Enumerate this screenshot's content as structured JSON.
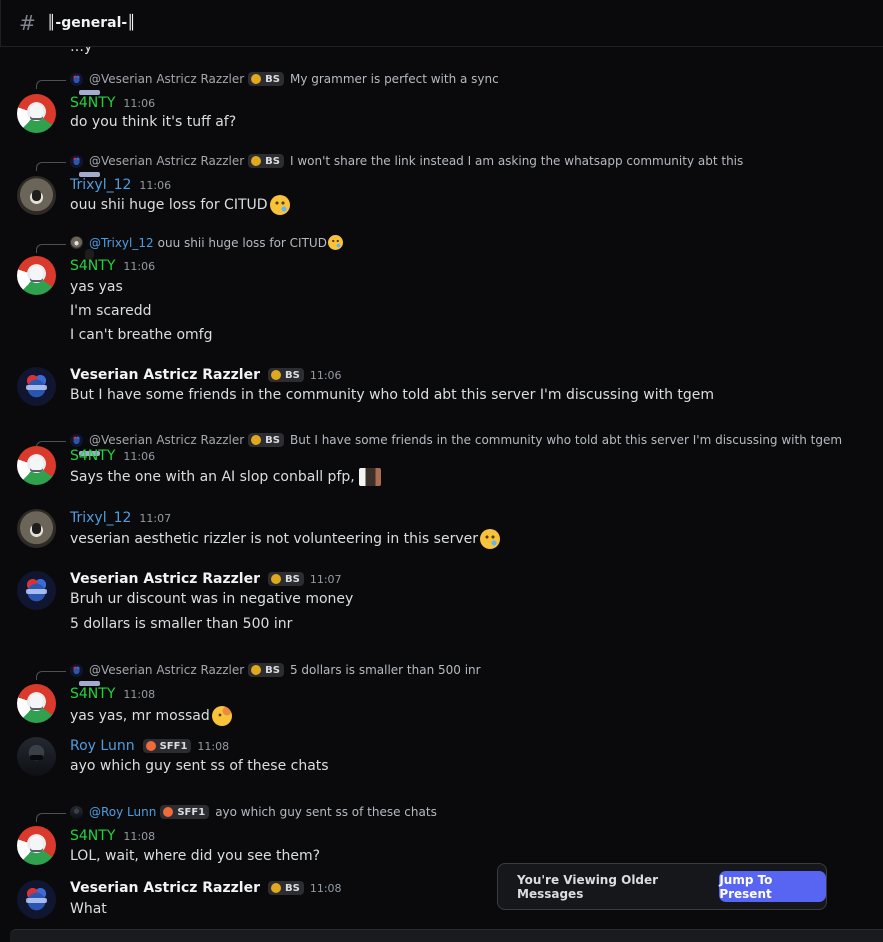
{
  "channel": {
    "icon": "hash-icon",
    "name": "║-general-║"
  },
  "cut_text": "…y",
  "messages": [
    {
      "reply": {
        "author": "@Veserian Astricz Razzler",
        "tag": "BS",
        "text": "My grammer is perfect with a sync"
      },
      "author": "S4NTY",
      "time": "11:06",
      "lines": [
        "do you think it's tuff af?"
      ]
    },
    {
      "reply": {
        "author": "@Veserian Astricz Razzler",
        "tag": "BS",
        "text": "I won't share the link instead I am asking the whatsapp community abt this"
      },
      "author": "Trixyl_12",
      "time": "11:06",
      "lines": [
        "ouu shii huge loss for CITUD"
      ],
      "emoji": "crying-face"
    },
    {
      "reply": {
        "author": "@Trixyl_12",
        "text": "ouu shii huge loss for CITUD"
      },
      "author": "S4NTY",
      "time": "11:06",
      "lines": [
        "yas yas",
        "I'm scaredd",
        "I can't breathe omfg"
      ]
    },
    {
      "author": "Veserian Astricz Razzler",
      "tag": "BS",
      "time": "11:06",
      "lines": [
        "But I have some friends in the community who told abt this server I'm discussing with tgem"
      ]
    },
    {
      "reply": {
        "author": "@Veserian Astricz Razzler",
        "tag": "BS",
        "text": "But I have some friends in the community who told abt this server I'm discussing with tgem"
      },
      "author": "S4NTY",
      "time": "11:06",
      "lines": [
        "Says the one with an AI slop conball pfp,"
      ]
    },
    {
      "author": "Trixyl_12",
      "time": "11:07",
      "lines": [
        "veserian aesthetic rizzler is not volunteering in this server"
      ]
    },
    {
      "author": "Veserian Astricz Razzler",
      "tag": "BS",
      "time": "11:07",
      "lines": [
        "Bruh ur discount was in negative money",
        "5 dollars is smaller than 500 inr"
      ]
    },
    {
      "reply": {
        "author": "@Veserian Astricz Razzler",
        "tag": "BS",
        "text": "5 dollars is smaller than 500 inr"
      },
      "author": "S4NTY",
      "time": "11:08",
      "lines": [
        "yas yas, mr mossad"
      ]
    },
    {
      "author": "Roy Lunn",
      "tag": "SFF1",
      "time": "11:08",
      "lines": [
        "ayo which guy sent ss of these chats"
      ]
    },
    {
      "reply": {
        "author": "@Roy Lunn",
        "tag": "SFF1",
        "text": "ayo which guy sent ss of these chats"
      },
      "author": "S4NTY",
      "time": "11:08",
      "lines": [
        "LOL, wait, where did you see them?"
      ]
    },
    {
      "author": "Veserian Astricz Razzler",
      "tag": "BS",
      "time": "11:08",
      "lines": [
        "What"
      ]
    }
  ],
  "toast": {
    "text": "You're Viewing Older Messages",
    "button": "Jump To Present"
  },
  "colors": {
    "accent": "#5865f2",
    "santy": "#22d43b",
    "link": "#4f9ddf",
    "bg": "#0a0a0c"
  }
}
